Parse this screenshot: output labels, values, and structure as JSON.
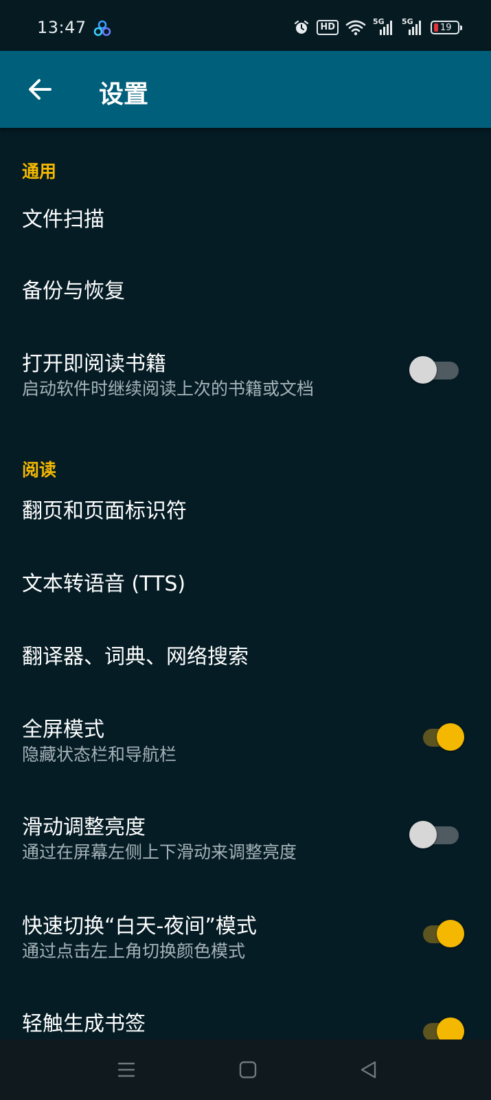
{
  "status_bar": {
    "time": "13:47",
    "hd_label": "HD",
    "network_1": "5G",
    "network_2": "5G",
    "battery_level": "19",
    "icons": [
      "app-icon",
      "alarm-icon",
      "hd-icon",
      "wifi-icon",
      "signal-5g-icon",
      "signal-5g-icon",
      "battery-icon"
    ],
    "battery_color": "#e5323c"
  },
  "app_bar": {
    "title": "设置",
    "back_icon": "arrow-left-icon",
    "color": "#005f7a"
  },
  "sections": [
    {
      "header": "通用",
      "items": [
        {
          "title": "文件扫描"
        },
        {
          "title": "备份与恢复"
        },
        {
          "title": "打开即阅读书籍",
          "subtitle": "启动软件时继续阅读上次的书籍或文档",
          "toggle": false
        }
      ]
    },
    {
      "header": "阅读",
      "items": [
        {
          "title": "翻页和页面标识符"
        },
        {
          "title": "文本转语音 (TTS)"
        },
        {
          "title": "翻译器、词典、网络搜索"
        },
        {
          "title": "全屏模式",
          "subtitle": "隐藏状态栏和导航栏",
          "toggle": true
        },
        {
          "title": "滑动调整亮度",
          "subtitle": "通过在屏幕左侧上下滑动来调整亮度",
          "toggle": false
        },
        {
          "title": "快速切换“白天-夜间”模式",
          "subtitle": "通过点击左上角切换颜色模式",
          "toggle": true
        },
        {
          "title": "轻触生成书签",
          "toggle": true
        }
      ]
    }
  ],
  "nav_bar": {
    "icons": [
      "menu-icon",
      "home-square-icon",
      "back-triangle-icon"
    ]
  },
  "colors": {
    "accent": "#f5b800",
    "background": "#051c25",
    "toggle_off_thumb": "#d7d7d7"
  }
}
